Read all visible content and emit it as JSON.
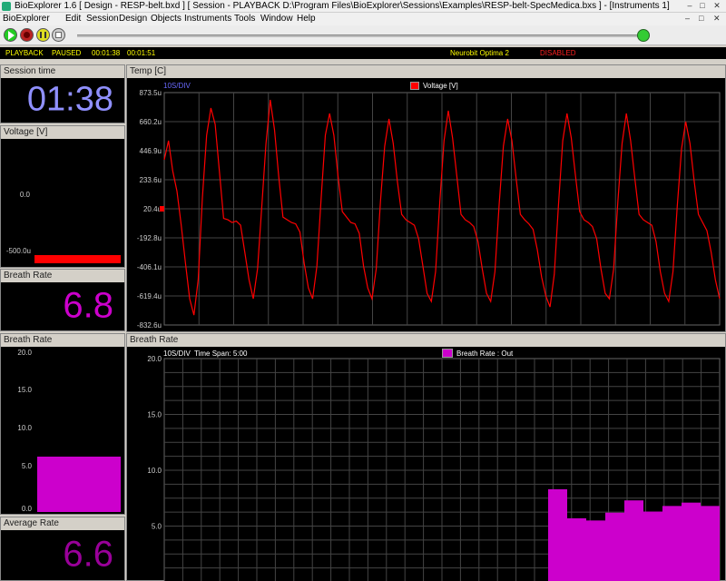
{
  "window": {
    "title": "BioExplorer 1.6  [ Design - RESP-belt.bxd ] [ Session - PLAYBACK D:\\Program Files\\BioExplorer\\Sessions\\Examples\\RESP-belt-SpecMedica.bxs ] - [Instruments 1]",
    "minimize": "–",
    "maximize": "□",
    "close": "✕"
  },
  "menu": {
    "items": [
      "BioExplorer",
      "Edit",
      "Session",
      "Design",
      "Objects",
      "Instruments",
      "Tools",
      "Window",
      "Help"
    ],
    "doc_min": "–",
    "doc_max": "□",
    "doc_close": "✕"
  },
  "toolbar": {
    "play_icon": "play-icon",
    "record_icon": "record-icon",
    "pause_icon": "pause-icon",
    "stop_icon": "stop-icon",
    "progress": 0.98
  },
  "status": {
    "mode": "PLAYBACK",
    "state": "PAUSED",
    "elapsed": "00:01:38",
    "total": "00:01:51",
    "device": "Neurobit Optima 2",
    "device_state": "DISABLED",
    "colors": {
      "yellow": "#ffff00",
      "red": "#ff2020"
    }
  },
  "panels": {
    "session_time": {
      "title": "Session time",
      "value": "01:38",
      "color": "#9090ff"
    },
    "voltage": {
      "title": "Voltage [V]",
      "ticks": [
        "0.0",
        "-500.0u"
      ],
      "level": 0.07,
      "color": "#ff0000"
    },
    "breath_rate": {
      "title": "Breath Rate",
      "value": "6.8",
      "color": "#cc00cc"
    },
    "breath_rate_bar": {
      "title": "Breath Rate",
      "ticks": [
        "20.0",
        "15.0",
        "10.0",
        "5.0",
        "0.0"
      ],
      "level": 0.34,
      "color": "#cc00cc"
    },
    "average_rate": {
      "title": "Average Rate",
      "value": "6.6",
      "color": "#990099"
    },
    "temp": {
      "title": "Temp [C]",
      "div_label": "10S/DIV",
      "legend": "Voltage [V]",
      "legend_color": "#ff0000",
      "marker_value": "20.4u"
    },
    "breath_chart": {
      "title": "Breath Rate",
      "div_label": "10S/DIV",
      "span_label": "Time Span: 5:00",
      "legend": "Breath Rate : Out",
      "legend_color": "#cc00cc"
    }
  },
  "chart_data": [
    {
      "type": "line",
      "legend": [
        "Voltage [V]"
      ],
      "ylim": [
        -832.6,
        873.5
      ],
      "yunit": "u",
      "yticks": [
        "873.5u",
        "660.2u",
        "446.9u",
        "233.6u",
        "20.4u",
        "-192.8u",
        "-406.1u",
        "-619.4u",
        "-832.6u"
      ],
      "grid": true,
      "series": [
        {
          "name": "Voltage [V]",
          "color": "#ff0000",
          "values": [
            380,
            520,
            300,
            150,
            -100,
            -380,
            -640,
            -760,
            -500,
            100,
            560,
            760,
            640,
            300,
            -50,
            -60,
            -80,
            -70,
            -100,
            -300,
            -500,
            -640,
            -420,
            40,
            500,
            820,
            600,
            260,
            -40,
            -60,
            -80,
            -90,
            -150,
            -380,
            -560,
            -640,
            -400,
            100,
            560,
            720,
            560,
            260,
            0,
            -40,
            -80,
            -90,
            -160,
            -400,
            -560,
            -640,
            -420,
            80,
            480,
            680,
            500,
            220,
            -20,
            -60,
            -80,
            -100,
            -200,
            -400,
            -600,
            -660,
            -440,
            80,
            520,
            740,
            540,
            260,
            -20,
            -60,
            -80,
            -110,
            -220,
            -420,
            -600,
            -660,
            -440,
            60,
            480,
            680,
            520,
            240,
            -20,
            -60,
            -90,
            -130,
            -280,
            -480,
            -620,
            -700,
            -460,
            60,
            520,
            720,
            540,
            260,
            0,
            -60,
            -80,
            -110,
            -200,
            -420,
            -600,
            -640,
            -420,
            80,
            500,
            720,
            520,
            240,
            -20,
            -60,
            -80,
            -100,
            -220,
            -440,
            -600,
            -660,
            -440,
            40,
            460,
            660,
            500,
            220,
            -20,
            -80,
            -140,
            -300,
            -500,
            -640
          ]
        }
      ]
    },
    {
      "type": "bar",
      "legend": [
        "Breath Rate : Out"
      ],
      "ylim": [
        0,
        20
      ],
      "yticks": [
        "20.0",
        "15.0",
        "10.0",
        "5.0"
      ],
      "grid": true,
      "xlabel_left": "10S/DIV",
      "time_span": "Time Span: 5:00",
      "series": [
        {
          "name": "Breath Rate : Out",
          "color": "#cc00cc",
          "values": [
            8.3,
            5.7,
            5.5,
            6.2,
            7.3,
            6.3,
            6.8,
            7.1,
            6.8
          ]
        }
      ]
    }
  ]
}
